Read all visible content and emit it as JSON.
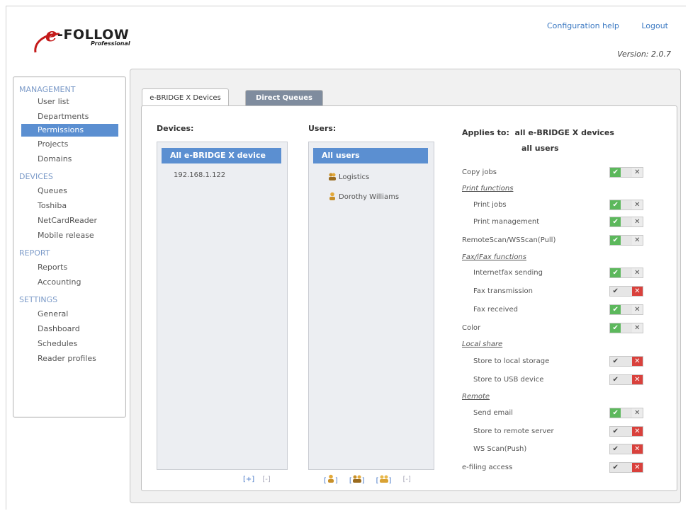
{
  "header": {
    "logo_text": "FOLLOW",
    "logo_sub": "Professional",
    "config_help": "Configuration help",
    "logout": "Logout",
    "version": "Version: 2.0.7"
  },
  "sidebar": {
    "management": "MANAGEMENT",
    "management_items": [
      "User list",
      "Departments",
      "Permissions",
      "Projects",
      "Domains"
    ],
    "devices": "DEVICES",
    "devices_items": [
      "Queues",
      "Toshiba",
      "NetCardReader",
      "Mobile release"
    ],
    "report": "REPORT",
    "report_items": [
      "Reports",
      "Accounting"
    ],
    "settings": "SETTINGS",
    "settings_items": [
      "General",
      "Dashboard",
      "Schedules",
      "Reader profiles"
    ],
    "active": "Permissions"
  },
  "tabs": {
    "active": "e-BRIDGE X Devices",
    "inactive": "Direct Queues"
  },
  "devices": {
    "title": "Devices:",
    "selected": "All e-BRIDGE X device",
    "items": [
      "192.168.1.122"
    ],
    "add": "[+]",
    "remove": "[-]"
  },
  "users": {
    "title": "Users:",
    "selected": "All users",
    "items": [
      "Logistics",
      "Dorothy Williams"
    ],
    "remove": "[-]"
  },
  "applies": {
    "label": "Applies to:",
    "devices": "all e-BRIDGE X devices",
    "users": "all users"
  },
  "permissions": {
    "copy_jobs": "Copy jobs",
    "print_functions": "Print functions",
    "print_jobs": "Print jobs",
    "print_management": "Print management",
    "remote_scan": "RemoteScan/WSScan(Pull)",
    "fax_functions": "Fax/iFax functions",
    "internetfax": "Internetfax sending",
    "fax_transmission": "Fax transmission",
    "fax_received": "Fax received",
    "color": "Color",
    "local_share": "Local share",
    "store_local": "Store to local storage",
    "store_usb": "Store to USB device",
    "remote": "Remote",
    "send_email": "Send email",
    "store_remote": "Store to remote server",
    "ws_scan_push": "WS Scan(Push)",
    "efiling": "e-filing access",
    "states": {
      "copy_jobs": "allowed",
      "print_jobs": "allowed",
      "print_management": "allowed",
      "remote_scan": "allowed",
      "internetfax": "allowed",
      "fax_transmission": "denied",
      "fax_received": "allowed",
      "color": "allowed",
      "store_local": "denied",
      "store_usb": "denied",
      "send_email": "allowed",
      "store_remote": "denied",
      "ws_scan_push": "denied",
      "efiling": "denied"
    }
  },
  "colors": {
    "accent": "#5b8fd1",
    "allow": "#5cb85c",
    "deny": "#d9413c",
    "tab_inactive": "#7f8c9e"
  }
}
